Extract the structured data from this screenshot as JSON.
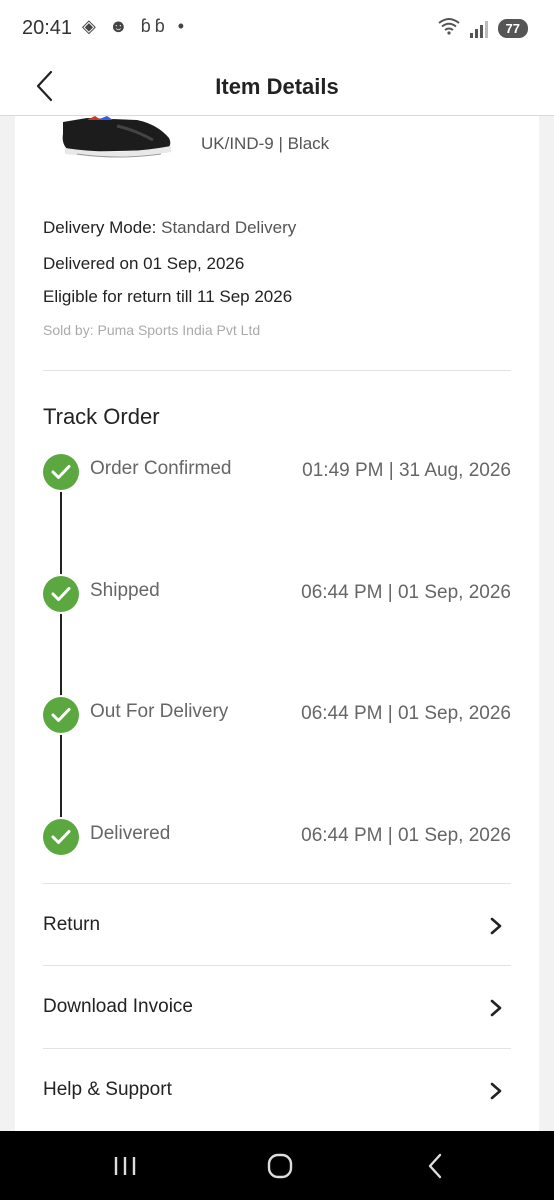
{
  "status_bar": {
    "time": "20:41",
    "notification_icons": "◈ ☻ ɓɓ •",
    "battery": "77"
  },
  "header": {
    "title": "Item Details"
  },
  "product": {
    "variant": "UK/IND-9 | Black"
  },
  "delivery": {
    "mode_label": "Delivery Mode:",
    "mode_value": "Standard Delivery",
    "delivered_on": "Delivered on 01 Sep, 2026",
    "return_eligibility": "Eligible for return till 11 Sep 2026",
    "sold_by": "Sold by: Puma Sports India Pvt Ltd"
  },
  "track_order": {
    "title": "Track Order",
    "steps": [
      {
        "label": "Order Confirmed",
        "time": "01:49 PM | 31 Aug, 2026"
      },
      {
        "label": "Shipped",
        "time": "06:44 PM | 01 Sep, 2026"
      },
      {
        "label": "Out For Delivery",
        "time": "06:44 PM | 01 Sep, 2026"
      },
      {
        "label": "Delivered",
        "time": "06:44 PM | 01 Sep, 2026"
      }
    ]
  },
  "actions": [
    {
      "label": "Return"
    },
    {
      "label": "Download Invoice"
    },
    {
      "label": "Help & Support"
    }
  ],
  "colors": {
    "check_green": "#5aa83f",
    "nav_bar": "#000000"
  }
}
